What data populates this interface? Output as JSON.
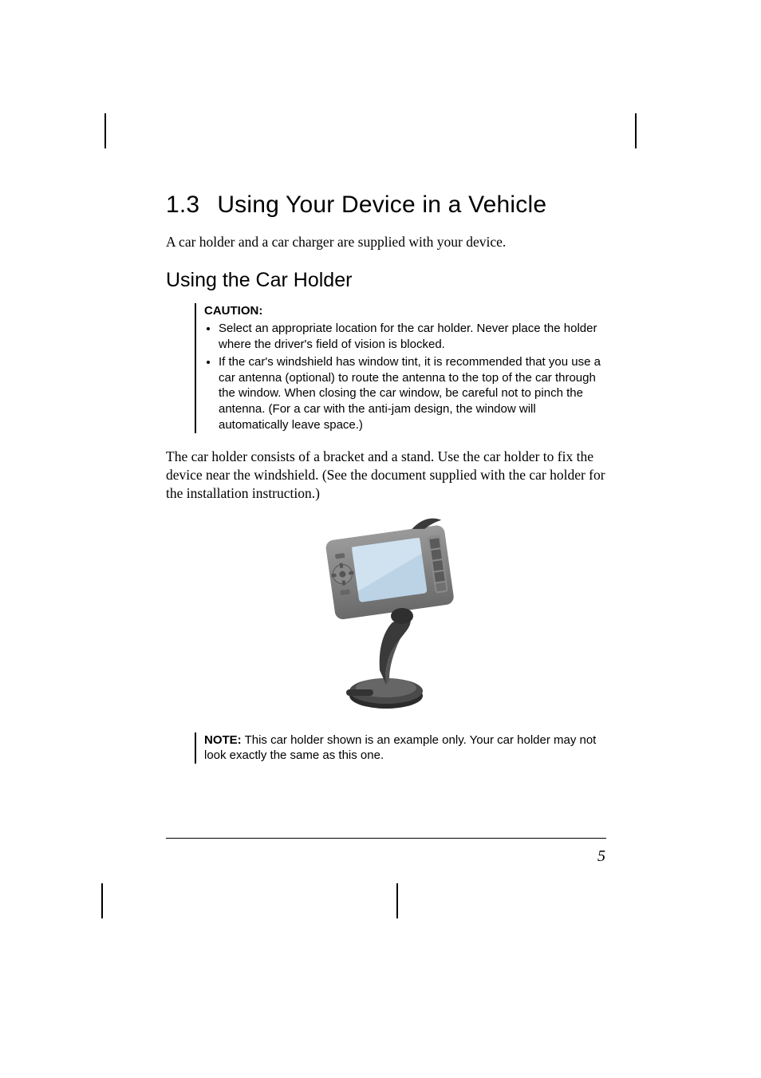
{
  "section": {
    "number": "1.3",
    "title": "Using Your Device in a Vehicle"
  },
  "intro": "A car holder and a car charger are supplied with your device.",
  "sub_heading": "Using the Car Holder",
  "caution": {
    "label": "CAUTION:",
    "items": [
      "Select an appropriate location for the car holder. Never place the holder where the driver's field of vision is blocked.",
      "If the car's windshield has window tint, it is recommended that you use a car antenna (optional) to route the antenna to the top of the car through the window. When closing the car window, be careful not to pinch the antenna. (For a car with the anti-jam design, the window will automatically leave space.)"
    ]
  },
  "body": "The car holder consists of a bracket and a stand. Use the car holder to fix the device near the windshield. (See the document supplied with the car holder for the installation instruction.)",
  "note": {
    "label": "NOTE:",
    "text": " This car holder shown is an example only. Your car holder may not look exactly the same as this one."
  },
  "page_number": "5",
  "figure_alt": "device-in-car-holder-illustration"
}
